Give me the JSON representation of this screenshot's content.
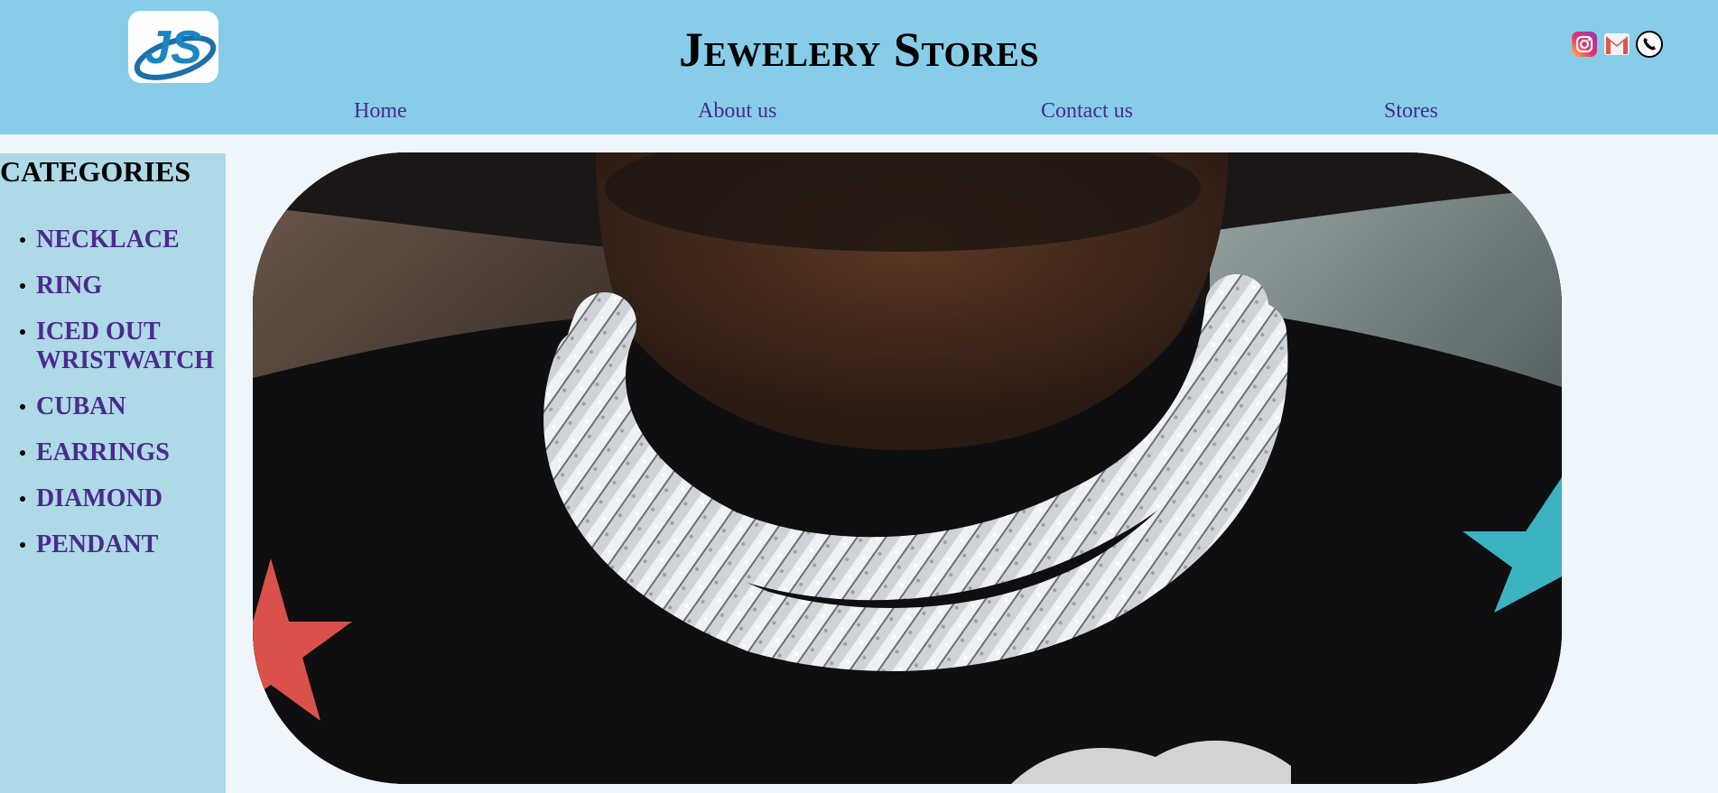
{
  "header": {
    "title": "Jewelery Stores",
    "logo_text": "JS",
    "logo_icon": "js-logo-icon",
    "social_icons": [
      "instagram-icon",
      "gmail-icon",
      "phone-icon"
    ]
  },
  "nav": {
    "items": [
      "Home",
      "About us",
      "Contact us",
      "Stores"
    ]
  },
  "sidebar": {
    "title": "CATEGORIES",
    "items": [
      "NECKLACE",
      "RING",
      "ICED OUT WRISTWATCH",
      "CUBAN",
      "EARRINGS",
      "DIAMOND",
      "PENDANT"
    ]
  },
  "hero": {
    "image_icon": "necklace-photo"
  },
  "colors": {
    "header_bg": "#87cdea",
    "sidebar_bg": "#aed9e6",
    "page_bg": "#eef6fc",
    "link": "#4b2a8f"
  }
}
